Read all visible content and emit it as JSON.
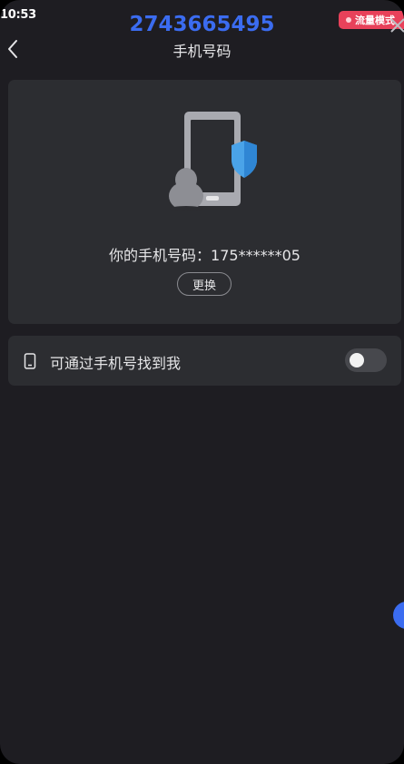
{
  "status_bar": {
    "time": "10:53",
    "flow_mode_badge": "流量模式"
  },
  "header": {
    "account_id": "2743665495",
    "title": "手机号码"
  },
  "card": {
    "phone_number_text": "你的手机号码：175******05",
    "change_button_label": "更换"
  },
  "settings": {
    "find_me_by_phone": {
      "label": "可通过手机号找到我",
      "enabled": false
    }
  },
  "colors": {
    "background": "#1e1d22",
    "card": "#2c2d31",
    "accent": "#3b6cf0",
    "badge": "#e8415a"
  }
}
